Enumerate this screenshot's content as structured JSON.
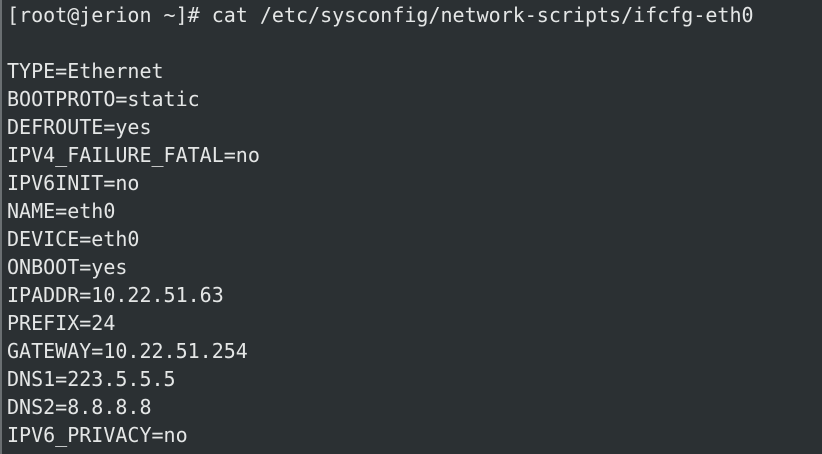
{
  "terminal": {
    "prompt": "[root@jerion ~]# ",
    "command": "cat /etc/sysconfig/network-scripts/ifcfg-eth0",
    "output_lines": [
      "TYPE=Ethernet",
      "BOOTPROTO=static",
      "DEFROUTE=yes",
      "IPV4_FAILURE_FATAL=no",
      "IPV6INIT=no",
      "NAME=eth0",
      "DEVICE=eth0",
      "ONBOOT=yes",
      "IPADDR=10.22.51.63",
      "PREFIX=24",
      "GATEWAY=10.22.51.254",
      "DNS1=223.5.5.5",
      "DNS2=8.8.8.8",
      "IPV6_PRIVACY=no"
    ],
    "colors": {
      "background": "#2b3033",
      "text": "#e4e6e6",
      "border": "#6a6f72"
    }
  }
}
